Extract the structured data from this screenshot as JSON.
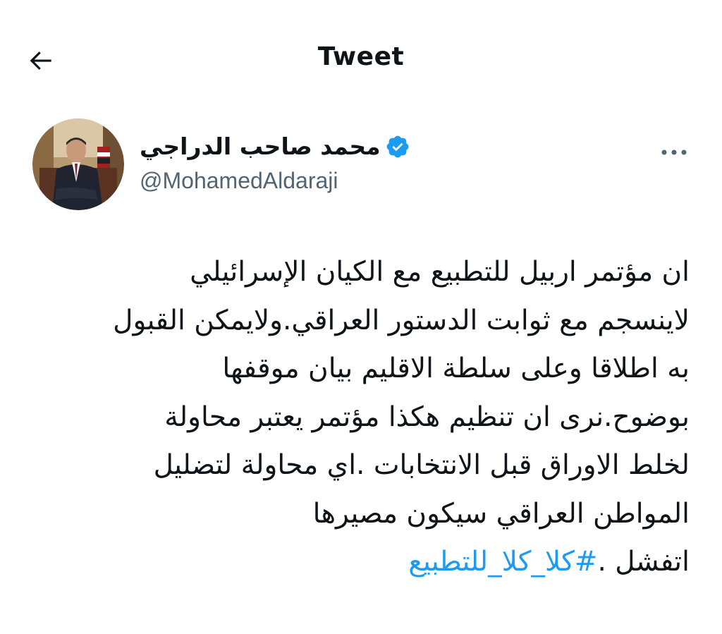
{
  "header": {
    "title": "Tweet",
    "back_icon": "arrow-left-icon"
  },
  "author": {
    "display_name": "محمد صاحب الدراجي",
    "handle": "@MohamedAldaraji",
    "verified_icon": "verified-badge-icon",
    "verified_color": "#1d9bf0",
    "more_icon": "more-horizontal-icon"
  },
  "tweet": {
    "lines": [
      "ان مؤتمر اربيل للتطبيع مع الكيان الإسرائيلي",
      "لاينسجم مع  ثوابت الدستور العراقي.ولايمكن القبول",
      "به اطلاقا وعلى سلطة الاقليم بيان موقفها",
      "بوضوح.نرى ان تنظيم هكذا مؤتمر يعتبر محاولة",
      "لخلط الاوراق قبل  الانتخابات .اي محاولة لتضليل",
      "المواطن العراقي  سيكون مصيرها"
    ],
    "last_line_text": "اتفشل .",
    "hashtag": "#كلا_كلا_للتطبيع",
    "hashtag_color": "#1d9bf0"
  }
}
